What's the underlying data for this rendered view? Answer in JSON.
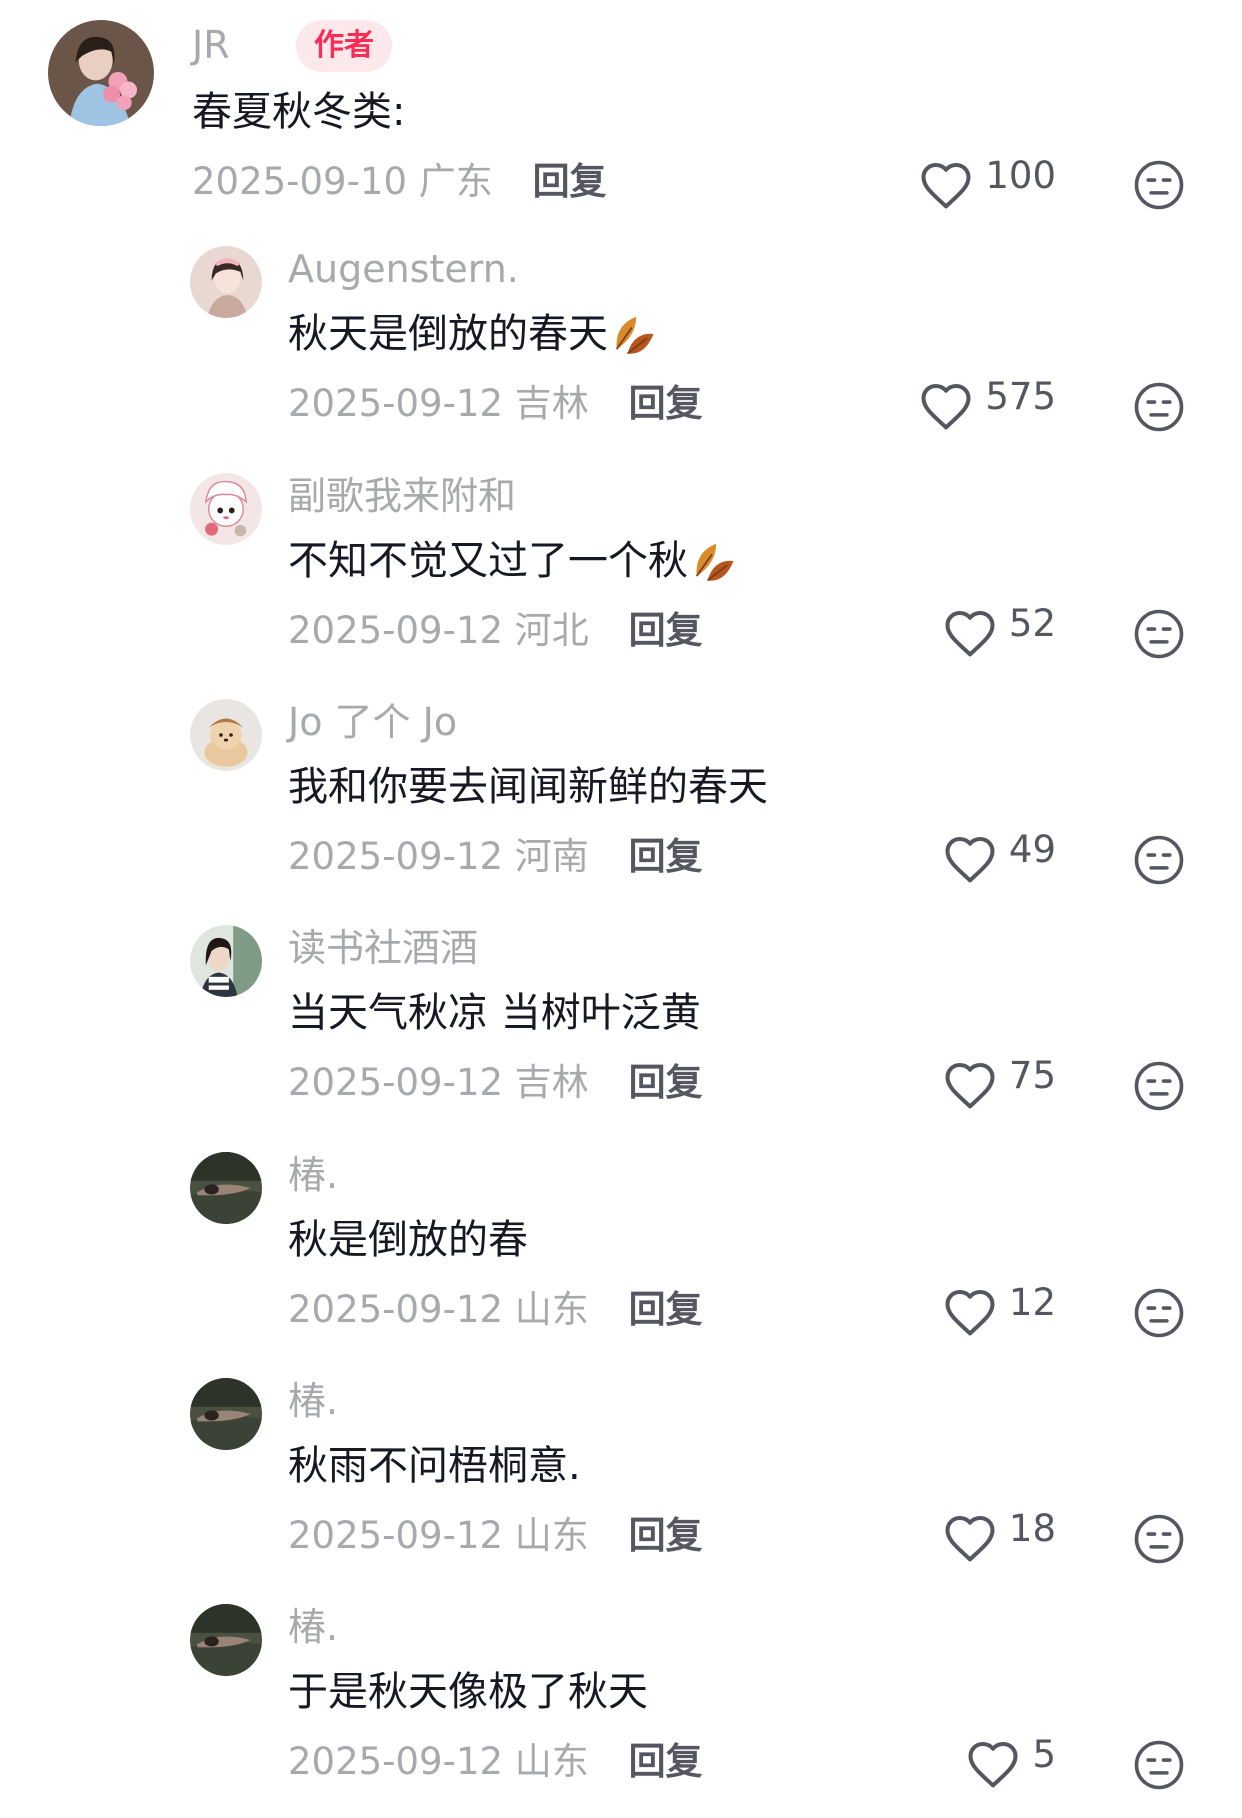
{
  "main_comment": {
    "username": "JR",
    "badge": "作者",
    "text": "春夏秋冬类:",
    "date": "2025-09-10",
    "location": "广东",
    "reply_label": "回复",
    "likes": "100",
    "icons": {
      "like": "heart-outline-icon",
      "dislike": "neutral-face-icon"
    }
  },
  "replies": [
    {
      "username": "Augenstern.",
      "text": "秋天是倒放的春天",
      "emoji": "fallen-leaf-emoji",
      "date": "2025-09-12",
      "location": "吉林",
      "reply_label": "回复",
      "likes": "575"
    },
    {
      "username": "副歌我来附和",
      "text": "不知不觉又过了一个秋",
      "emoji": "fallen-leaf-emoji",
      "date": "2025-09-12",
      "location": "河北",
      "reply_label": "回复",
      "likes": "52"
    },
    {
      "username": "Jo 了个 Jo",
      "text": "我和你要去闻闻新鲜的春天",
      "date": "2025-09-12",
      "location": "河南",
      "reply_label": "回复",
      "likes": "49"
    },
    {
      "username": "读书社酒酒",
      "text": "当天气秋凉 当树叶泛黄",
      "date": "2025-09-12",
      "location": "吉林",
      "reply_label": "回复",
      "likes": "75"
    },
    {
      "username": "椿.",
      "text": "秋是倒放的春",
      "date": "2025-09-12",
      "location": "山东",
      "reply_label": "回复",
      "likes": "12"
    },
    {
      "username": "椿.",
      "text": "秋雨不问梧桐意.",
      "date": "2025-09-12",
      "location": "山东",
      "reply_label": "回复",
      "likes": "18"
    },
    {
      "username": "椿.",
      "text": "于是秋天像极了秋天",
      "date": "2025-09-12",
      "location": "山东",
      "reply_label": "回复",
      "likes": "5"
    }
  ],
  "colors": {
    "text_primary": "#161823",
    "text_secondary": "#a8a9ad",
    "reply_button": "#555660",
    "badge_bg": "#fde8ec",
    "badge_text": "#fe2c55"
  }
}
